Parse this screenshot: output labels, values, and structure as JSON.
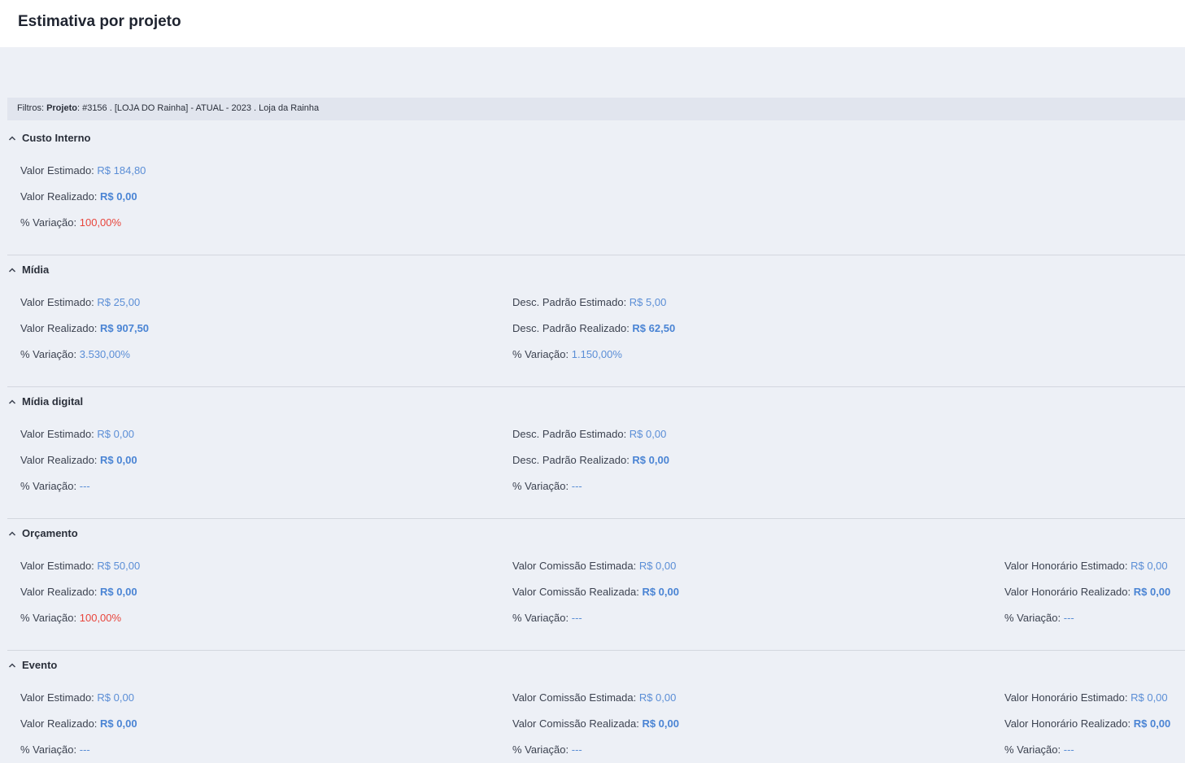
{
  "page": {
    "title": "Estimativa por projeto"
  },
  "filters": {
    "prefix": "Filtros:",
    "key": "Projeto",
    "value": ": #3156 . [LOJA DO Rainha] - ATUAL - 2023 . Loja da Rainha"
  },
  "colors": {
    "value_blue": "#5b8ed6",
    "value_bold_blue": "#4a84d4",
    "variation_red": "#e8453c"
  },
  "icons": {
    "section_toggle": "chevron-up-icon"
  },
  "sections": [
    {
      "title": "Custo Interno",
      "columns": [
        {
          "rows": [
            {
              "label": "Valor Estimado:",
              "value": "R$ 184,80"
            },
            {
              "label": "Valor Realizado:",
              "value": "R$ 0,00"
            },
            {
              "label": "% Variação:",
              "value": "100,00%"
            }
          ]
        }
      ]
    },
    {
      "title": "Mídia",
      "columns": [
        {
          "rows": [
            {
              "label": "Valor Estimado:",
              "value": "R$ 25,00"
            },
            {
              "label": "Valor Realizado:",
              "value": "R$ 907,50"
            },
            {
              "label": "% Variação:",
              "value": "3.530,00%"
            }
          ]
        },
        {
          "rows": [
            {
              "label": "Desc. Padrão Estimado:",
              "value": "R$ 5,00"
            },
            {
              "label": "Desc. Padrão Realizado:",
              "value": "R$ 62,50"
            },
            {
              "label": "% Variação:",
              "value": "1.150,00%"
            }
          ]
        }
      ]
    },
    {
      "title": "Mídia digital",
      "columns": [
        {
          "rows": [
            {
              "label": "Valor Estimado:",
              "value": "R$ 0,00"
            },
            {
              "label": "Valor Realizado:",
              "value": "R$ 0,00"
            },
            {
              "label": "% Variação:",
              "value": "---"
            }
          ]
        },
        {
          "rows": [
            {
              "label": "Desc. Padrão Estimado:",
              "value": "R$ 0,00"
            },
            {
              "label": "Desc. Padrão Realizado:",
              "value": "R$ 0,00"
            },
            {
              "label": "% Variação:",
              "value": "---"
            }
          ]
        }
      ]
    },
    {
      "title": "Orçamento",
      "columns": [
        {
          "rows": [
            {
              "label": "Valor Estimado:",
              "value": "R$ 50,00"
            },
            {
              "label": "Valor Realizado:",
              "value": "R$ 0,00"
            },
            {
              "label": "% Variação:",
              "value": "100,00%"
            }
          ]
        },
        {
          "rows": [
            {
              "label": "Valor Comissão Estimada:",
              "value": "R$ 0,00"
            },
            {
              "label": "Valor Comissão Realizada:",
              "value": "R$ 0,00"
            },
            {
              "label": "% Variação:",
              "value": "---"
            }
          ]
        },
        {
          "rows": [
            {
              "label": "Valor Honorário Estimado:",
              "value": "R$ 0,00"
            },
            {
              "label": "Valor Honorário Realizado:",
              "value": "R$ 0,00"
            },
            {
              "label": "% Variação:",
              "value": "---"
            }
          ]
        }
      ]
    },
    {
      "title": "Evento",
      "columns": [
        {
          "rows": [
            {
              "label": "Valor Estimado:",
              "value": "R$ 0,00"
            },
            {
              "label": "Valor Realizado:",
              "value": "R$ 0,00"
            },
            {
              "label": "% Variação:",
              "value": "---"
            }
          ]
        },
        {
          "rows": [
            {
              "label": "Valor Comissão Estimada:",
              "value": "R$ 0,00"
            },
            {
              "label": "Valor Comissão Realizada:",
              "value": "R$ 0,00"
            },
            {
              "label": "% Variação:",
              "value": "---"
            }
          ]
        },
        {
          "rows": [
            {
              "label": "Valor Honorário Estimado:",
              "value": "R$ 0,00"
            },
            {
              "label": "Valor Honorário Realizado:",
              "value": "R$ 0,00"
            },
            {
              "label": "% Variação:",
              "value": "---"
            }
          ]
        }
      ]
    }
  ]
}
